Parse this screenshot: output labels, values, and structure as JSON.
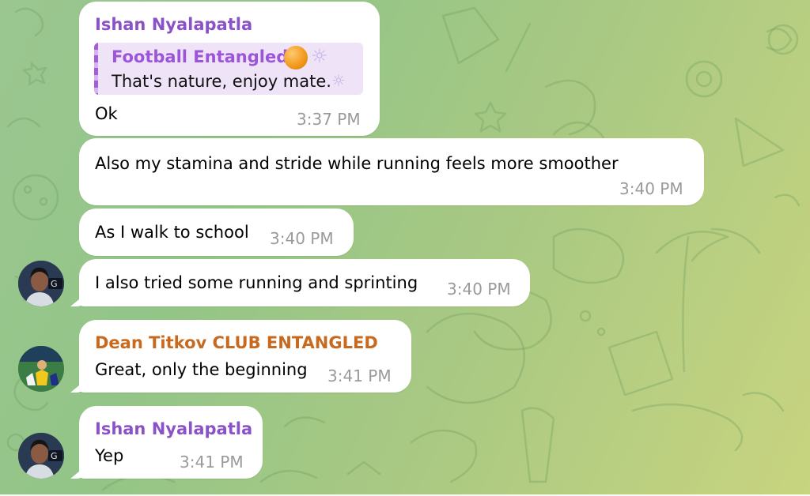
{
  "colors": {
    "sender_ishan": "#8b52c7",
    "sender_dean": "#c8691e",
    "reply_accent": "#a45dd6",
    "timestamp": "#999a9b"
  },
  "messages": [
    {
      "sender": "Ishan Nyalapatla",
      "reply": {
        "name": "Football Entangled",
        "icon": "orange-ball-emoji",
        "text": "That's nature, enjoy mate."
      },
      "text": "Ok",
      "time": "3:37 PM"
    },
    {
      "text": "Also my stamina and stride while running feels more smoother",
      "time": "3:40 PM"
    },
    {
      "text": "As I walk to school",
      "time": "3:40 PM"
    },
    {
      "text": "I also tried some running and sprinting",
      "time": "3:40 PM",
      "avatar": "ishan-avatar"
    },
    {
      "sender": "Dean Titkov CLUB ENTANGLED",
      "text": "Great, only the beginning",
      "time": "3:41 PM",
      "avatar": "dean-avatar"
    },
    {
      "sender": "Ishan Nyalapatla",
      "text": "Yep",
      "time": "3:41 PM",
      "avatar": "ishan-avatar"
    }
  ]
}
